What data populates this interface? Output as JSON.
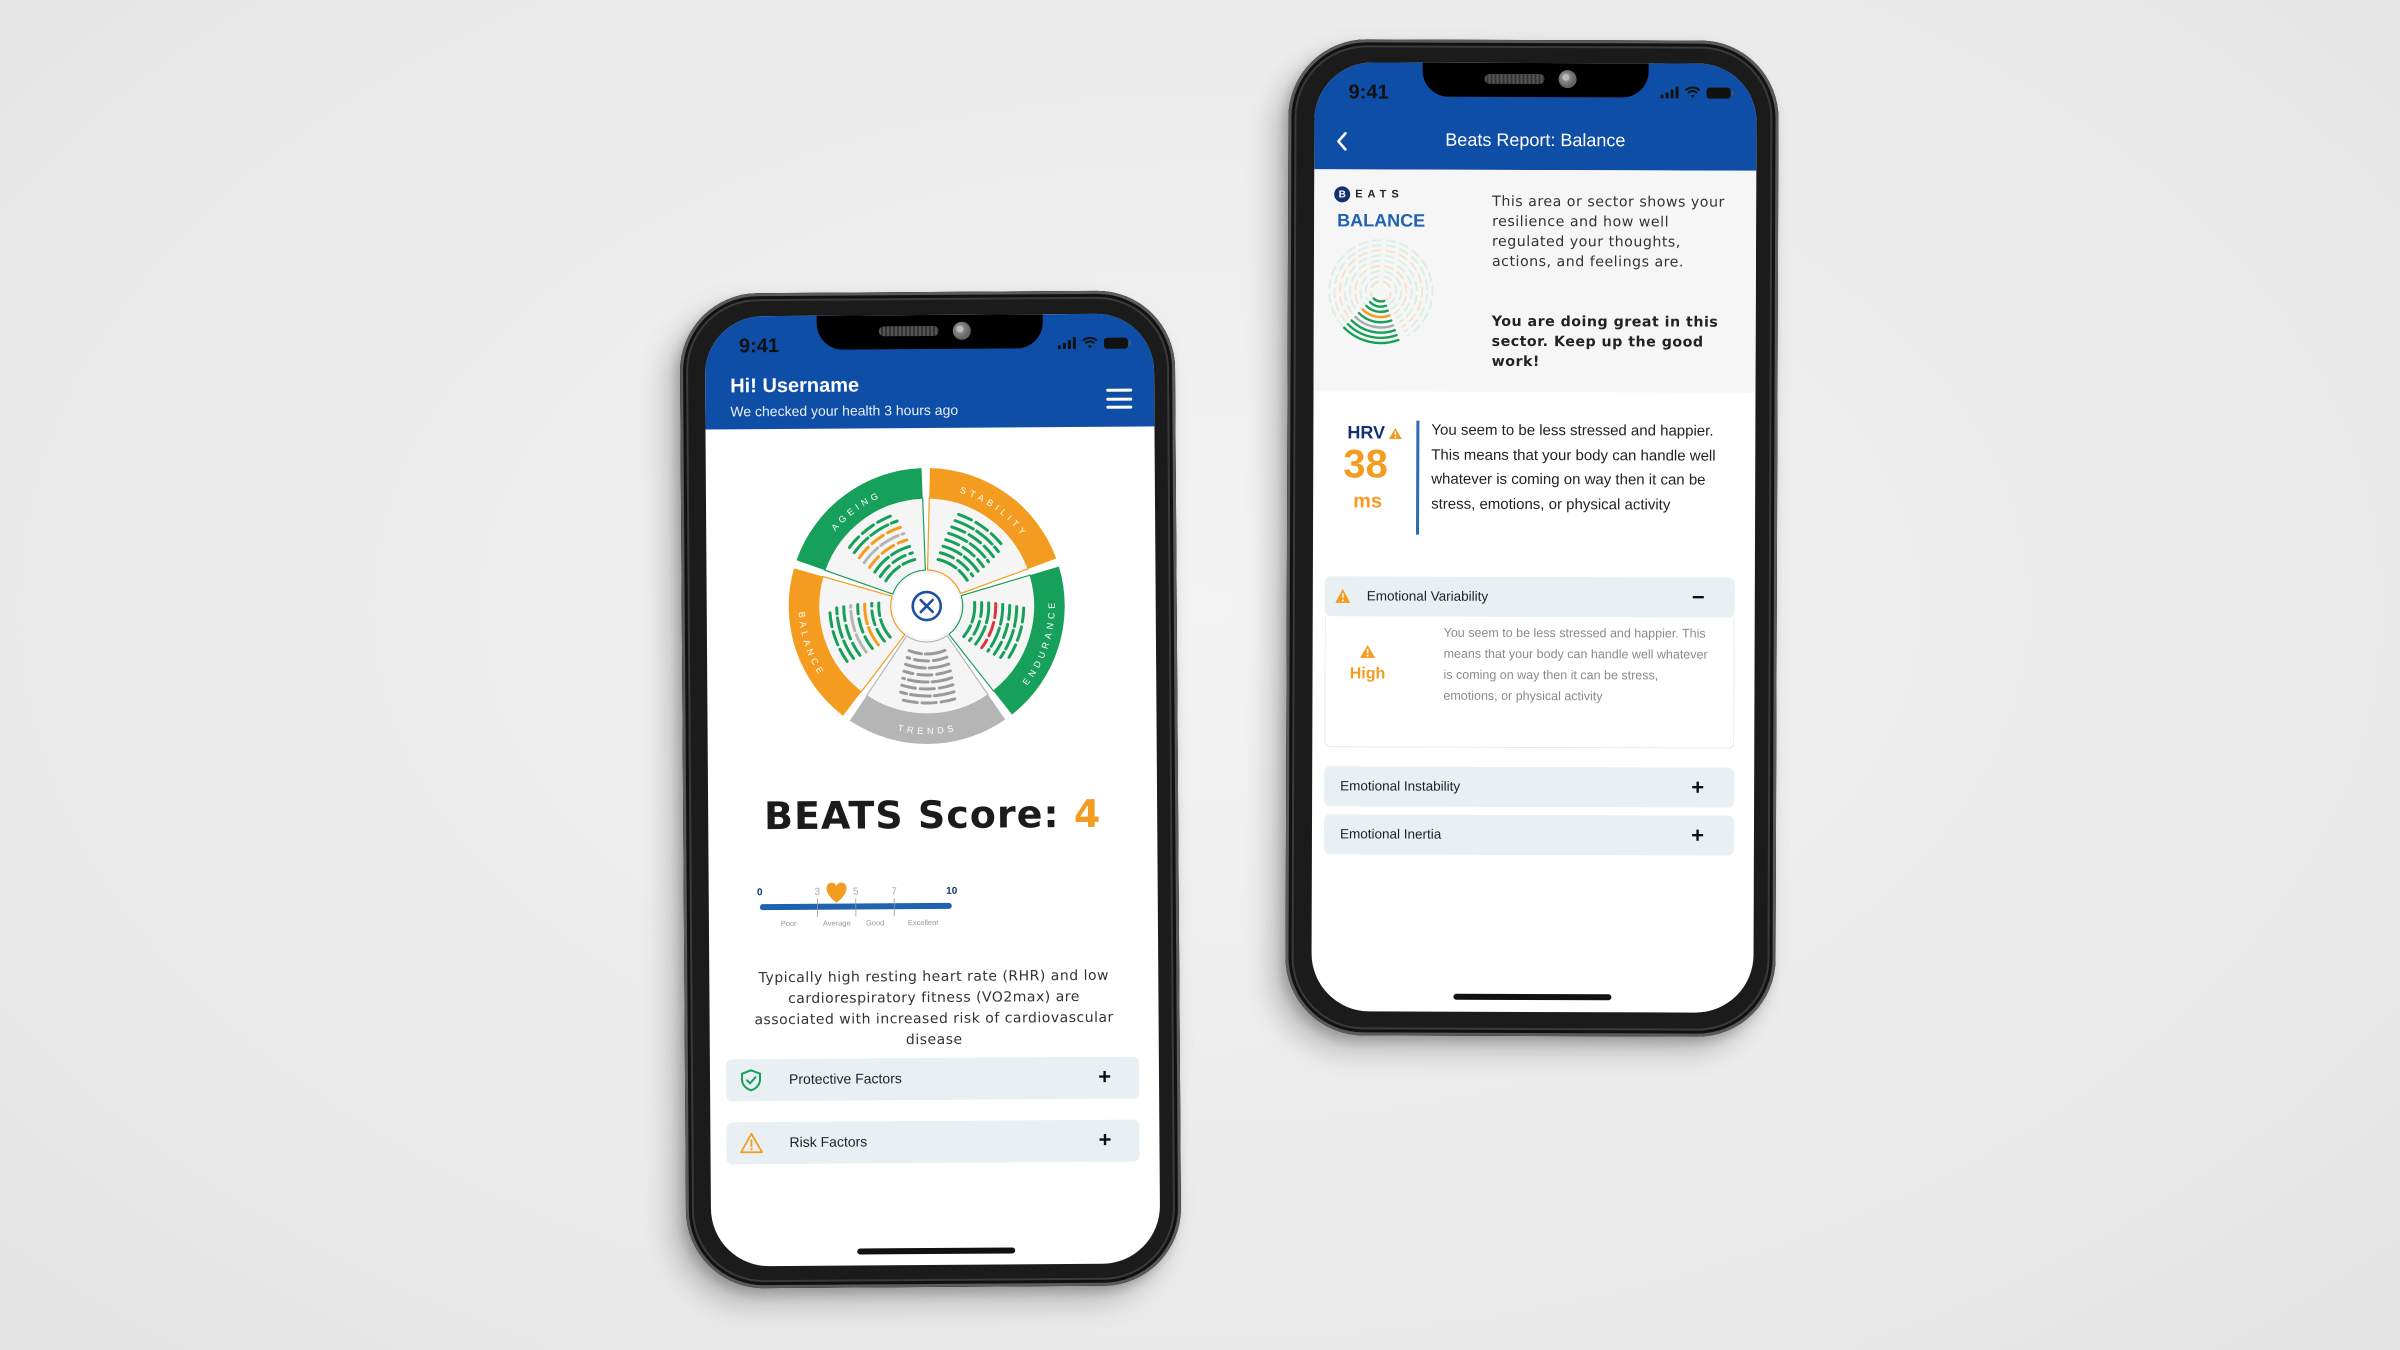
{
  "left_phone": {
    "status_bar": {
      "time": "9:41"
    },
    "header": {
      "title": "Hi! Username",
      "subtitle": "We checked your health 3 hours ago",
      "menu_icon": "hamburger-menu-icon"
    },
    "wheel": {
      "center_icon": "close-circle-icon",
      "sectors": [
        {
          "label": "AGEING",
          "color": "#16a05a"
        },
        {
          "label": "STABILITY",
          "color": "#f39c1f"
        },
        {
          "label": "ENDURANCE",
          "color": "#16a05a"
        },
        {
          "label": "TRENDS",
          "color": "#b5b5b5"
        },
        {
          "label": "BALANCE",
          "color": "#f39c1f"
        }
      ]
    },
    "score": {
      "label": "BEATS Score:",
      "value": "4",
      "scale_min": 0,
      "scale_max": 10,
      "ticks": [
        "0",
        "3",
        "5",
        "7",
        "10"
      ],
      "bands": [
        "Poor",
        "Average",
        "Good",
        "Excellent"
      ],
      "marker_icon": "heart-icon"
    },
    "description": "Typically high resting heart rate (RHR) and low cardiorespiratory fitness (VO2max) are associated with increased risk of cardiovascular disease",
    "factors": [
      {
        "label": "Protective Factors",
        "icon": "shield-check-icon",
        "toggle": "+"
      },
      {
        "label": "Risk Factors",
        "icon": "warning-icon",
        "toggle": "+"
      }
    ]
  },
  "right_phone": {
    "status_bar": {
      "time": "9:41"
    },
    "header": {
      "title": "Beats Report: Balance",
      "back_icon": "chevron-left-icon"
    },
    "intro": {
      "logo_letter": "B",
      "logo_text": "EATS",
      "sector": "BALANCE",
      "text": "This area or sector shows your resilience and how well regulated your thoughts, actions, and feelings are.",
      "highlight": "You are doing great in this sector. Keep up the good work!"
    },
    "hrv": {
      "label": "HRV",
      "value": "38",
      "unit": "ms",
      "text": "You seem to be less stressed and happier. This means that your body can handle well whatever is coming on way then it can be stress, emotions, or physical activity"
    },
    "accordions": [
      {
        "label": "Emotional Variability",
        "toggle": "−",
        "expanded": true,
        "level": "High",
        "body": "You seem to be less stressed and happier. This means that your body can handle well whatever is coming on way then it can be stress, emotions, or physical activity"
      },
      {
        "label": "Emotional Instability",
        "toggle": "+",
        "expanded": false
      },
      {
        "label": "Emotional Inertia",
        "toggle": "+",
        "expanded": false
      }
    ]
  },
  "colors": {
    "brand_blue": "#0f4ea6",
    "navy": "#14306e",
    "green": "#16a05a",
    "orange": "#f39c1f",
    "gray": "#b5b5b5",
    "accordion_bg": "#e9f0f4"
  }
}
